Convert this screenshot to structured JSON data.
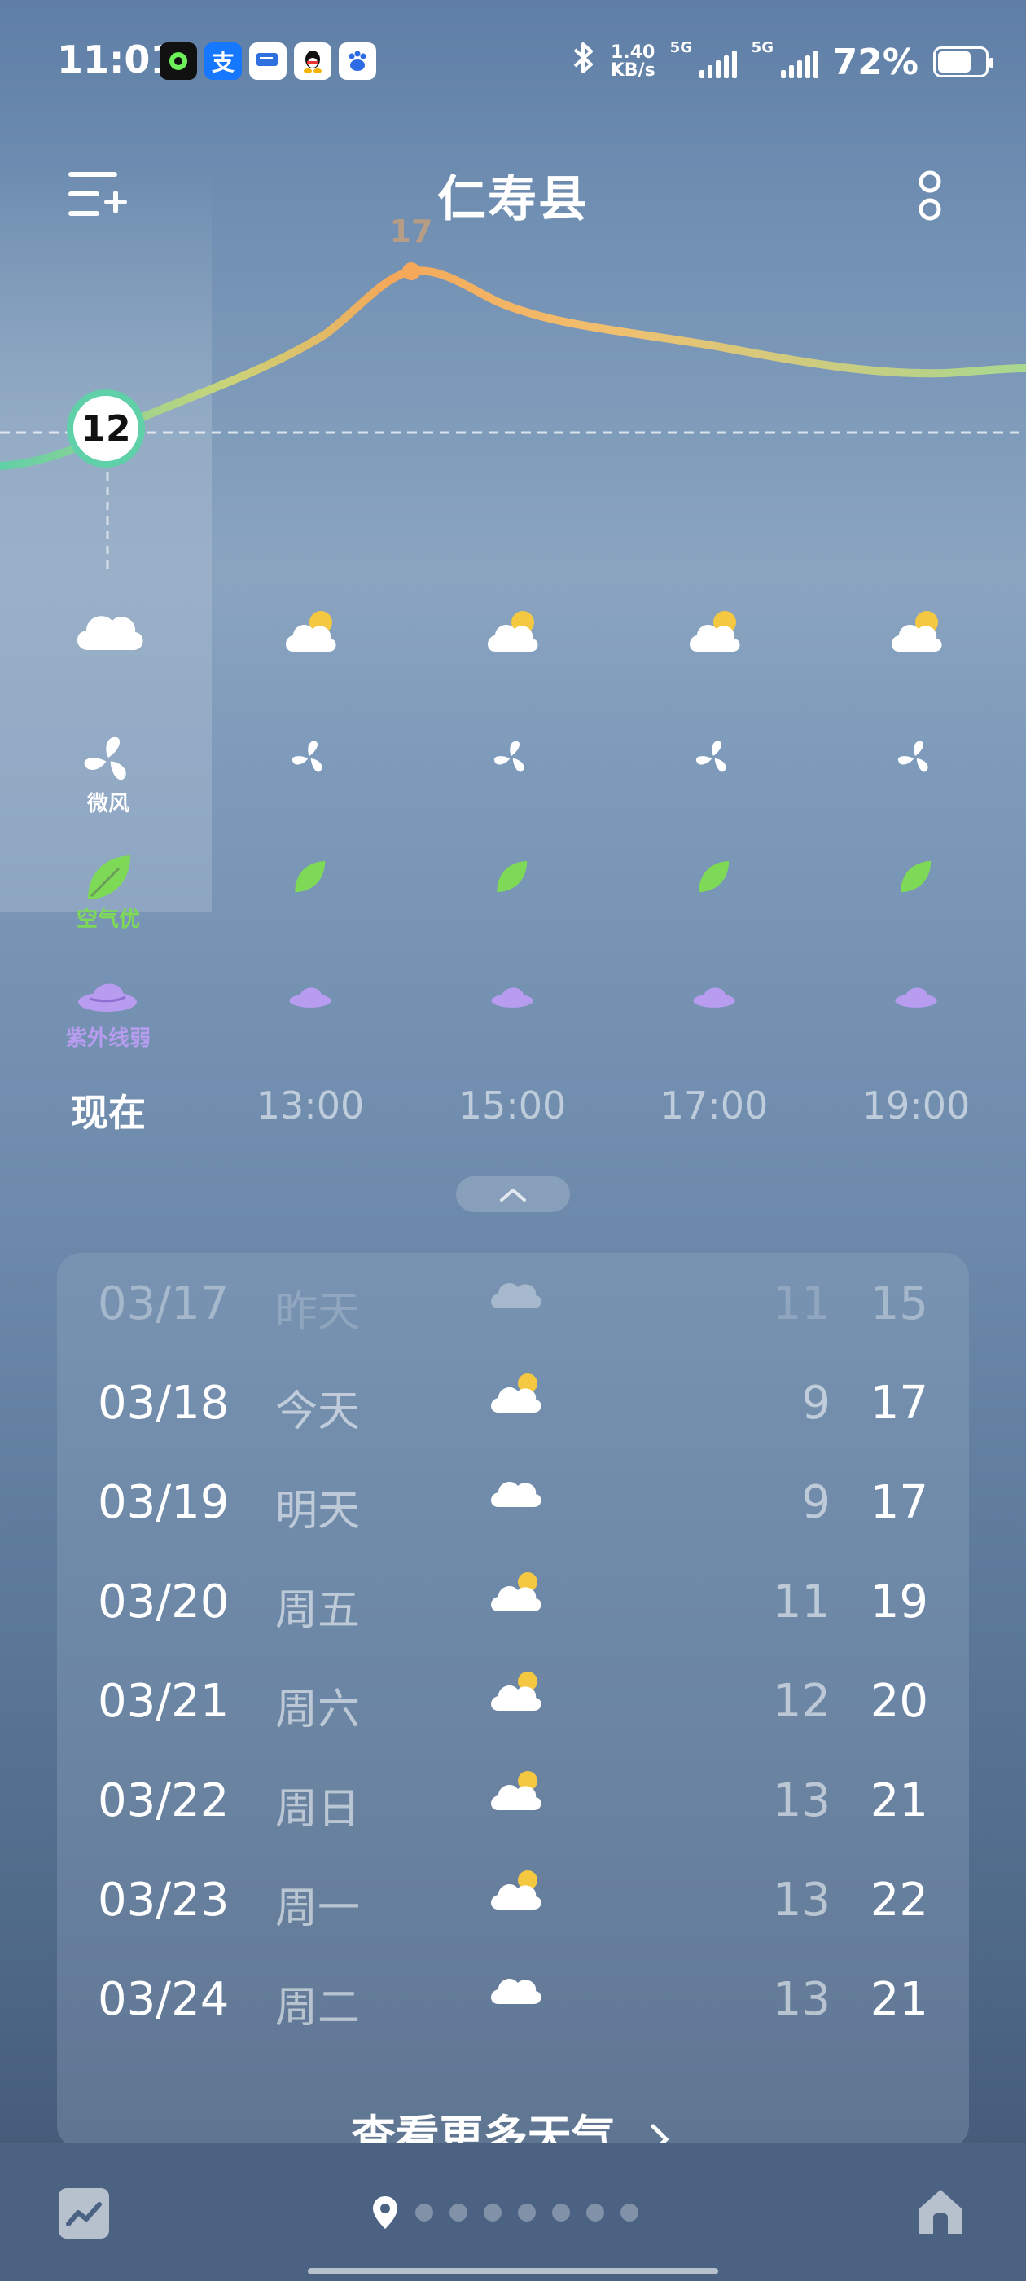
{
  "status_bar": {
    "time": "11:01",
    "net_speed_value": "1.40",
    "net_speed_unit": "KB/s",
    "sim1_label": "5G",
    "sim2_label": "5G",
    "battery_text": "72%",
    "battery_level": 0.72,
    "notification_icons": [
      "music-app-icon",
      "alipay-icon",
      "message-app-icon",
      "qq-icon",
      "baidu-icon"
    ]
  },
  "header": {
    "city": "仁寿县"
  },
  "hourly": {
    "current_temp": "12",
    "peak_temp": "17",
    "labels": {
      "wind": "微风",
      "air": "空气优",
      "uv": "紫外线弱"
    },
    "times": [
      "现在",
      "13:00",
      "15:00",
      "17:00",
      "19:00"
    ],
    "conditions": [
      "cloudy",
      "partly-cloudy",
      "partly-cloudy",
      "partly-cloudy",
      "partly-cloudy"
    ]
  },
  "daily": [
    {
      "date": "03/17",
      "week": "昨天",
      "icon": "cloudy",
      "low": "11",
      "high": "15",
      "past": true
    },
    {
      "date": "03/18",
      "week": "今天",
      "icon": "partly-cloudy",
      "low": "9",
      "high": "17",
      "past": false
    },
    {
      "date": "03/19",
      "week": "明天",
      "icon": "cloudy",
      "low": "9",
      "high": "17",
      "past": false
    },
    {
      "date": "03/20",
      "week": "周五",
      "icon": "partly-cloudy",
      "low": "11",
      "high": "19",
      "past": false
    },
    {
      "date": "03/21",
      "week": "周六",
      "icon": "partly-cloudy",
      "low": "12",
      "high": "20",
      "past": false
    },
    {
      "date": "03/22",
      "week": "周日",
      "icon": "partly-cloudy",
      "low": "13",
      "high": "21",
      "past": false
    },
    {
      "date": "03/23",
      "week": "周一",
      "icon": "partly-cloudy",
      "low": "13",
      "high": "22",
      "past": false
    },
    {
      "date": "03/24",
      "week": "周二",
      "icon": "cloudy",
      "low": "13",
      "high": "21",
      "past": false
    }
  ],
  "more_link": "查看更多天气",
  "colors": {
    "curve_start": "#5fd0a8",
    "curve_peak": "#f5a85a",
    "curve_end": "#a8d890",
    "air_good": "#7ed957",
    "uv_weak": "#b79cf0"
  }
}
